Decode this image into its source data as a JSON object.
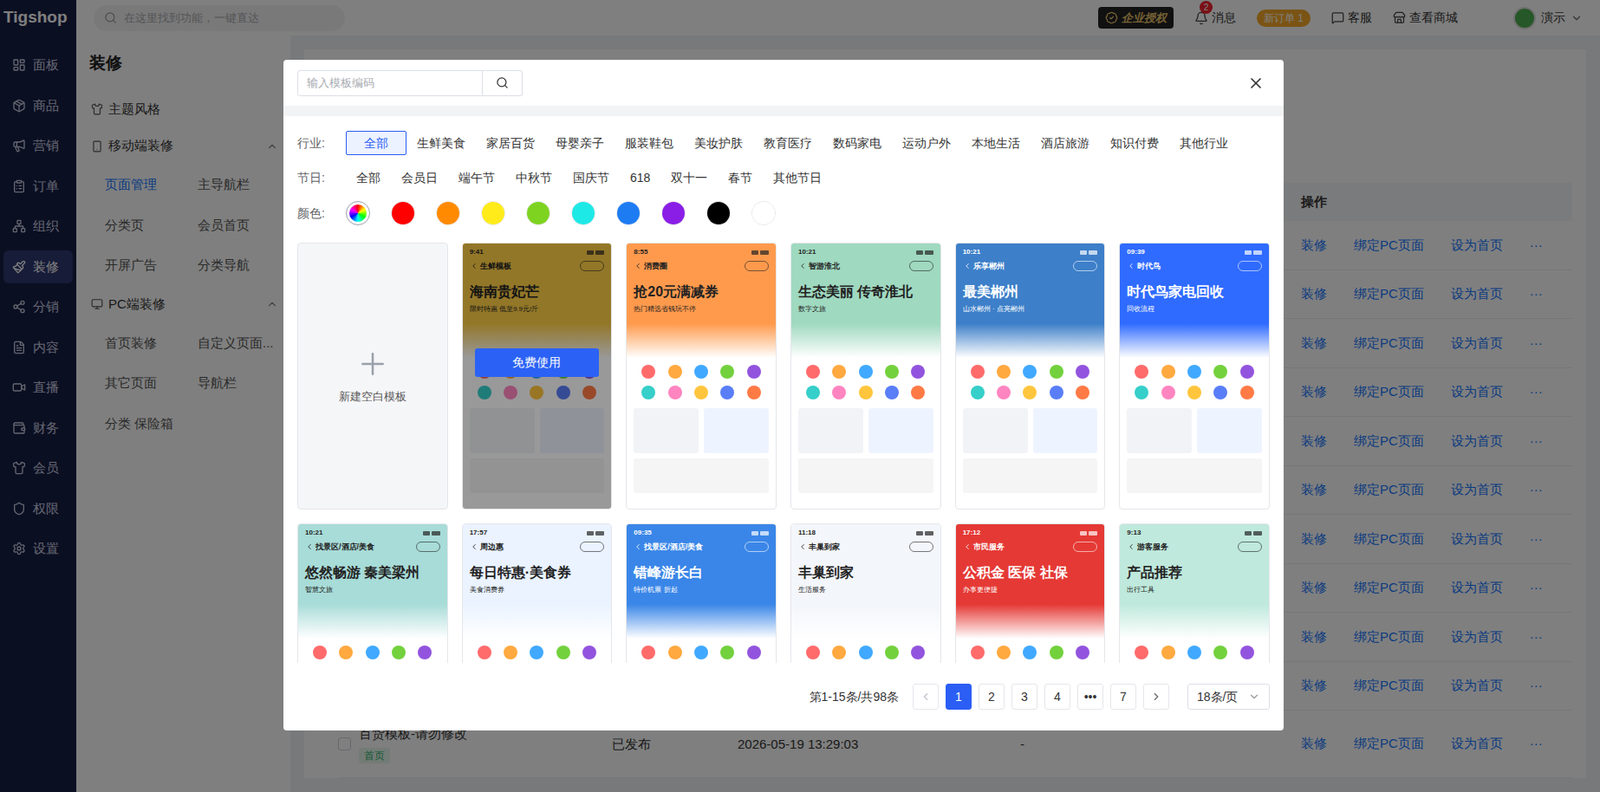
{
  "topbar": {
    "logo": "Tigshop",
    "search_placeholder": "在这里找到功能，一键直达",
    "license": "企业授权",
    "messages": {
      "label": "消息",
      "badge": "2"
    },
    "new_order": "新订单 1",
    "service": "客服",
    "view_store": "查看商城",
    "user": "演示"
  },
  "sidebar": {
    "items": [
      {
        "label": "面板",
        "selected": false
      },
      {
        "label": "商品",
        "selected": false
      },
      {
        "label": "营销",
        "selected": false
      },
      {
        "label": "订单",
        "selected": false
      },
      {
        "label": "组织",
        "selected": false
      },
      {
        "label": "装修",
        "selected": true
      },
      {
        "label": "分销",
        "selected": false
      },
      {
        "label": "内容",
        "selected": false
      },
      {
        "label": "直播",
        "selected": false
      },
      {
        "label": "财务",
        "selected": false
      },
      {
        "label": "会员",
        "selected": false
      },
      {
        "label": "权限",
        "selected": false
      },
      {
        "label": "设置",
        "selected": false
      }
    ]
  },
  "subnav": {
    "title": "装修",
    "items": [
      {
        "label": "主题风格",
        "kind": "link"
      },
      {
        "label": "移动端装修",
        "kind": "group",
        "expanded": true,
        "children": [
          {
            "label": "页面管理",
            "selected": true
          },
          {
            "label": "主导航栏",
            "selected": false
          },
          {
            "label": "分类页",
            "selected": false
          },
          {
            "label": "会员首页",
            "selected": false
          },
          {
            "label": "开屏广告",
            "selected": false
          },
          {
            "label": "分类导航",
            "selected": false
          }
        ]
      },
      {
        "label": "PC端装修",
        "kind": "group",
        "expanded": true,
        "children": [
          {
            "label": "首页装修",
            "selected": false
          },
          {
            "label": "自定义页面...",
            "selected": false
          },
          {
            "label": "其它页面",
            "selected": false
          },
          {
            "label": "导航栏",
            "selected": false
          },
          {
            "label": "分类 保险箱",
            "selected": false
          }
        ]
      }
    ]
  },
  "table": {
    "action_header": "操作",
    "rows": [
      {
        "actions": [
          "装修",
          "绑定PC页面",
          "设为首页",
          "···"
        ]
      },
      {
        "actions": [
          "装修",
          "绑定PC页面",
          "设为首页",
          "···"
        ]
      },
      {
        "actions": [
          "装修",
          "绑定PC页面",
          "设为首页",
          "···"
        ]
      },
      {
        "actions": [
          "装修",
          "绑定PC页面",
          "设为首页",
          "···"
        ]
      },
      {
        "actions": [
          "装修",
          "绑定PC页面",
          "设为首页",
          "···"
        ]
      },
      {
        "actions": [
          "装修",
          "绑定PC页面",
          "设为首页",
          "···"
        ]
      },
      {
        "actions": [
          "装修",
          "绑定PC页面",
          "设为首页",
          "···"
        ]
      },
      {
        "actions": [
          "装修",
          "绑定PC页面",
          "设为首页",
          "···"
        ]
      },
      {
        "actions": [
          "装修",
          "绑定PC页面",
          "设为首页",
          "···"
        ]
      },
      {
        "actions": [
          "装修",
          "绑定PC页面",
          "设为首页",
          "···"
        ]
      },
      {
        "name": "百货模板-请勿修改",
        "tag": "首页",
        "status": "已发布",
        "time": "2026-05-19 13:29:03",
        "extra": "-",
        "checked": false,
        "actions": [
          "装修",
          "绑定PC页面",
          "设为首页",
          "···"
        ]
      }
    ]
  },
  "template_modal": {
    "search_placeholder": "输入模板编码",
    "filters": [
      {
        "label": "行业:",
        "options": [
          {
            "label": "全部",
            "selected": true
          },
          {
            "label": "生鲜美食",
            "selected": false
          },
          {
            "label": "家居百货",
            "selected": false
          },
          {
            "label": "母婴亲子",
            "selected": false
          },
          {
            "label": "服装鞋包",
            "selected": false
          },
          {
            "label": "美妆护肤",
            "selected": false
          },
          {
            "label": "教育医疗",
            "selected": false
          },
          {
            "label": "数码家电",
            "selected": false
          },
          {
            "label": "运动户外",
            "selected": false
          },
          {
            "label": "本地生活",
            "selected": false
          },
          {
            "label": "酒店旅游",
            "selected": false
          },
          {
            "label": "知识付费",
            "selected": false
          },
          {
            "label": "其他行业",
            "selected": false
          }
        ]
      },
      {
        "label": "节日:",
        "options": [
          {
            "label": "全部",
            "selected": false
          },
          {
            "label": "会员日",
            "selected": false
          },
          {
            "label": "端午节",
            "selected": false
          },
          {
            "label": "中秋节",
            "selected": false
          },
          {
            "label": "国庆节",
            "selected": false
          },
          {
            "label": "618",
            "selected": false
          },
          {
            "label": "双十一",
            "selected": false
          },
          {
            "label": "春节",
            "selected": false
          },
          {
            "label": "其他节日",
            "selected": false
          }
        ]
      }
    ],
    "colors": {
      "label": "颜色:",
      "swatches": [
        {
          "kind": "all",
          "selected": true
        },
        {
          "kind": "swatch",
          "color": "#ff0000",
          "selected": false
        },
        {
          "kind": "swatch",
          "color": "#ff8a00",
          "selected": false
        },
        {
          "kind": "swatch",
          "color": "#ffeb1a",
          "selected": false
        },
        {
          "kind": "swatch",
          "color": "#7ed321",
          "selected": false
        },
        {
          "kind": "swatch",
          "color": "#1de9e6",
          "selected": false
        },
        {
          "kind": "swatch",
          "color": "#1e7cf2",
          "selected": false
        },
        {
          "kind": "swatch",
          "color": "#8a1ee6",
          "selected": false
        },
        {
          "kind": "swatch",
          "color": "#000000",
          "selected": false
        },
        {
          "kind": "swatch",
          "color": "#ffffff",
          "selected": false
        }
      ]
    },
    "templates": [
      {
        "kind": "blank",
        "label": "新建空白模板"
      },
      {
        "kind": "template",
        "time": "9:41",
        "title": "生鲜模板",
        "headline": "海南贵妃芒",
        "subline": "限时特惠 低至9.9元/斤",
        "color": "#f6c744",
        "hovered": true,
        "action": "免费使用"
      },
      {
        "kind": "template",
        "time": "8:55",
        "title": "消费圈",
        "headline": "抢20元满减券",
        "subline": "热门精选省钱玩不停",
        "color": "#ff9a4d",
        "hovered": false
      },
      {
        "kind": "template",
        "time": "10:21",
        "title": "智游淮北",
        "headline": "生态美丽 传奇淮北",
        "subline": "数字文旅",
        "color": "#9fd9c0",
        "hovered": false
      },
      {
        "kind": "template",
        "time": "10:21",
        "title": "乐享郴州",
        "headline": "最美郴州",
        "subline": "山水郴州 · 点亮郴州",
        "color": "#3d7fc9",
        "hovered": false
      },
      {
        "kind": "template",
        "time": "09:39",
        "title": "时代鸟",
        "headline": "时代鸟家电回收",
        "subline": "回收流程",
        "color": "#2f6bff",
        "hovered": false
      },
      {
        "kind": "template",
        "time": "10:21",
        "title": "找景区/酒店/美食",
        "headline": "悠然畅游 秦美梁州",
        "subline": "智慧文旅",
        "color": "#a8dcd8",
        "hovered": false
      },
      {
        "kind": "template",
        "time": "17:57",
        "title": "周边惠",
        "headline": "每日特惠·美食券",
        "subline": "美食消费券",
        "color": "#eaf3ff",
        "hovered": false
      },
      {
        "kind": "template",
        "time": "09:35",
        "title": "找景区/酒店/美食",
        "headline": "错峰游长白",
        "subline": "特价机票 折起",
        "color": "#3a86e8",
        "hovered": false
      },
      {
        "kind": "template",
        "time": "11:18",
        "title": "丰巢到家",
        "headline": "丰巢到家",
        "subline": "生活服务",
        "color": "#f3f6fa",
        "hovered": false
      },
      {
        "kind": "template",
        "time": "17:12",
        "title": "市民服务",
        "headline": "公积金  医保  社保",
        "subline": "办事更便捷",
        "color": "#e53935",
        "hovered": false
      },
      {
        "kind": "template",
        "time": "9:13",
        "title": "游客服务",
        "headline": "产品推荐",
        "subline": "出行工具",
        "color": "#bfe9dc",
        "hovered": false
      }
    ],
    "pagination": {
      "summary": "第1-15条/共98条",
      "pages": [
        {
          "label": "1",
          "selected": true
        },
        {
          "label": "2",
          "selected": false
        },
        {
          "label": "3",
          "selected": false
        },
        {
          "label": "4",
          "selected": false
        },
        {
          "label": "•••",
          "selected": false
        },
        {
          "label": "7",
          "selected": false
        }
      ],
      "page_size": "18条/页"
    }
  }
}
